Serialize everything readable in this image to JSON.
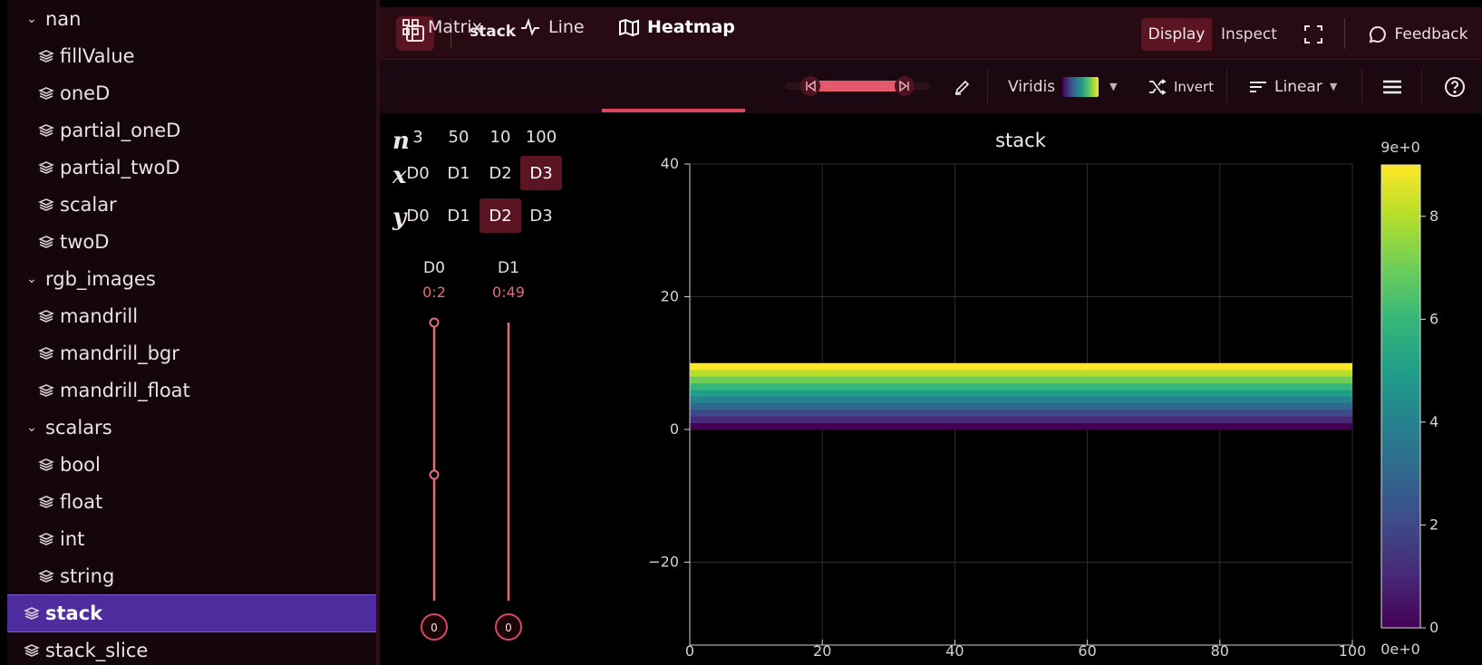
{
  "sidebar": {
    "items": [
      {
        "label": "nan",
        "type": "group",
        "expanded": true,
        "level": 1
      },
      {
        "label": "fillValue",
        "type": "dataset",
        "level": 2
      },
      {
        "label": "oneD",
        "type": "dataset",
        "level": 2
      },
      {
        "label": "partial_oneD",
        "type": "dataset",
        "level": 2
      },
      {
        "label": "partial_twoD",
        "type": "dataset",
        "level": 2
      },
      {
        "label": "scalar",
        "type": "dataset",
        "level": 2
      },
      {
        "label": "twoD",
        "type": "dataset",
        "level": 2
      },
      {
        "label": "rgb_images",
        "type": "group",
        "expanded": true,
        "level": 1
      },
      {
        "label": "mandrill",
        "type": "dataset",
        "level": 2
      },
      {
        "label": "mandrill_bgr",
        "type": "dataset",
        "level": 2
      },
      {
        "label": "mandrill_float",
        "type": "dataset",
        "level": 2
      },
      {
        "label": "scalars",
        "type": "group",
        "expanded": true,
        "level": 1
      },
      {
        "label": "bool",
        "type": "dataset",
        "level": 2
      },
      {
        "label": "float",
        "type": "dataset",
        "level": 2
      },
      {
        "label": "int",
        "type": "dataset",
        "level": 2
      },
      {
        "label": "string",
        "type": "dataset",
        "level": 2
      },
      {
        "label": "stack",
        "type": "dataset",
        "level": 1,
        "selected": true
      },
      {
        "label": "stack_slice",
        "type": "dataset",
        "level": 1
      }
    ]
  },
  "topbar": {
    "title": "stack",
    "display_label": "Display",
    "inspect_label": "Inspect",
    "feedback_label": "Feedback"
  },
  "toolbar": {
    "tabs": [
      {
        "label": "Matrix",
        "icon": "grid-icon",
        "active": false
      },
      {
        "label": "Line",
        "icon": "line-chart-icon",
        "active": false
      },
      {
        "label": "Heatmap",
        "icon": "map-icon",
        "active": true
      }
    ],
    "colormap_label": "Viridis",
    "invert_label": "Invert",
    "scale_label": "Linear"
  },
  "dims": {
    "n_label": "n",
    "x_label": "x",
    "y_label": "y",
    "sizes": [
      "3",
      "50",
      "10",
      "100"
    ],
    "names": [
      "D0",
      "D1",
      "D2",
      "D3"
    ],
    "x_selected": "D3",
    "y_selected": "D2",
    "sliders": [
      {
        "name": "D0",
        "range": "0:2",
        "value": "0"
      },
      {
        "name": "D1",
        "range": "0:49",
        "value": "0"
      }
    ]
  },
  "colors": {
    "accent": "#d8485d",
    "selected_row": "#4f2c9d",
    "topbar_bg": "#270a12"
  },
  "chart_data": {
    "type": "heatmap",
    "title": "stack",
    "colormap": "viridis",
    "x_range": [
      0,
      100
    ],
    "y_range": [
      -30,
      40
    ],
    "x_ticks": [
      0,
      20,
      40,
      60,
      80,
      100
    ],
    "y_ticks": [
      -20,
      0,
      20,
      40
    ],
    "grid": true,
    "rows": 10,
    "values_by_row": [
      0,
      1,
      2,
      3,
      4,
      5,
      6,
      7,
      8,
      9
    ],
    "colorbar": {
      "min_label": "0e+0",
      "max_label": "9e+0",
      "domain": [
        0,
        9
      ],
      "ticks": [
        0,
        2,
        4,
        6,
        8
      ]
    }
  }
}
